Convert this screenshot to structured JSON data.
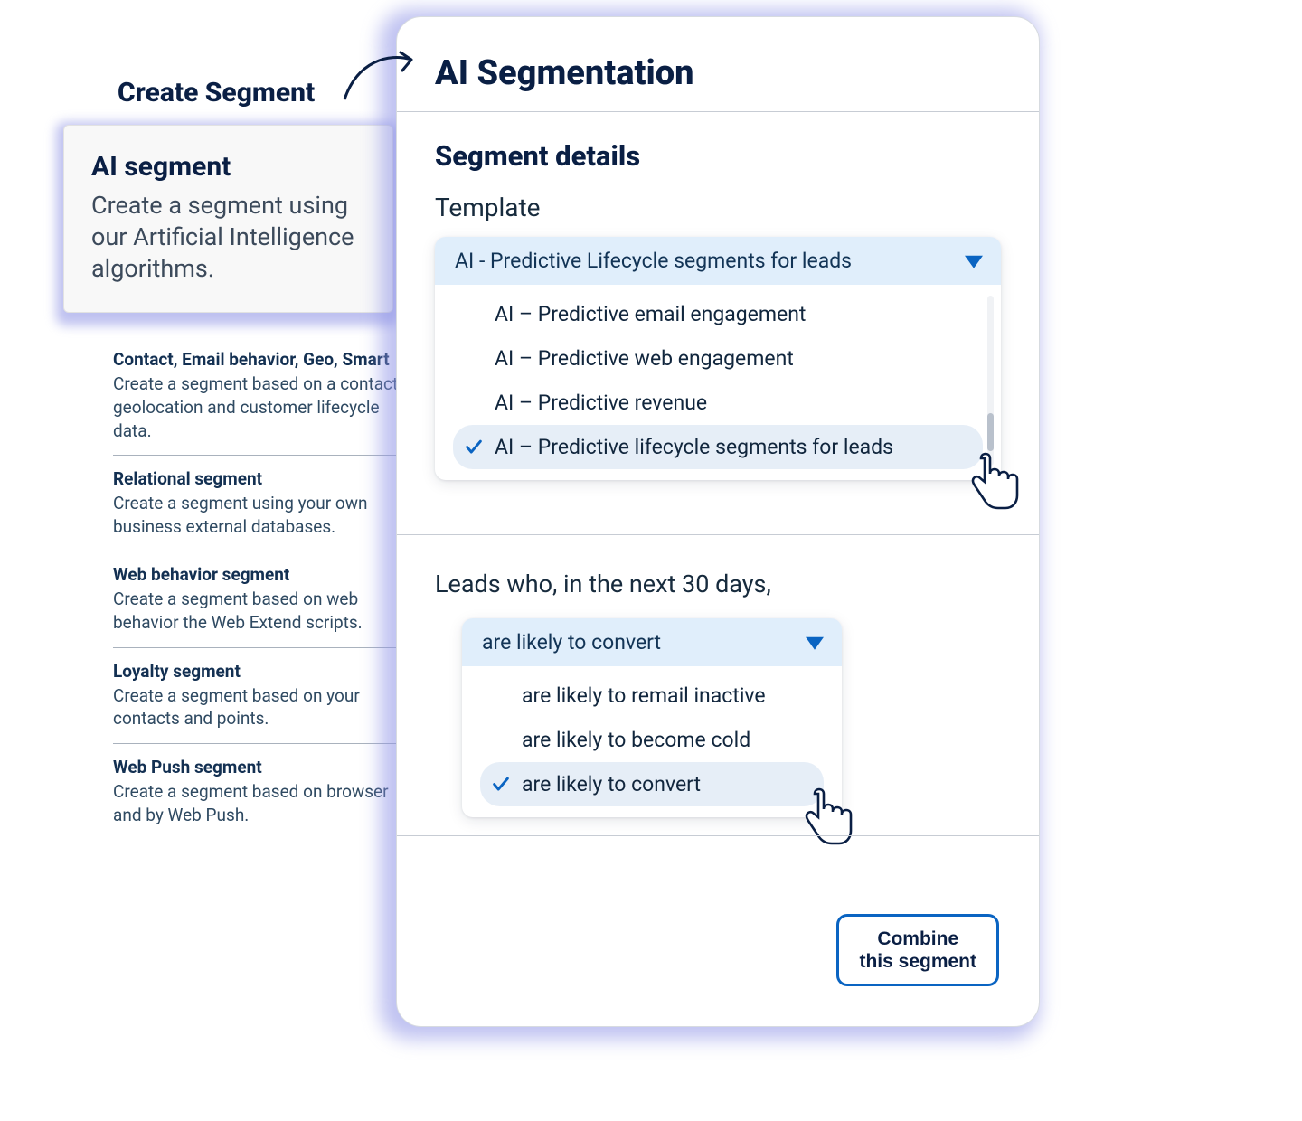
{
  "left": {
    "title": "Create Segment",
    "ai_card": {
      "heading": "AI segment",
      "text": "Create a segment using our Artificial Intelligence algorithms."
    },
    "items": [
      {
        "title": "Contact, Email behavior, Geo, Smart",
        "desc": "Create a segment based on a contact's geolocation and customer lifecycle data."
      },
      {
        "title": "Relational segment",
        "desc": "Create a segment using your own business external databases."
      },
      {
        "title": "Web behavior segment",
        "desc": "Create a segment based on web behavior the Web Extend scripts."
      },
      {
        "title": "Loyalty segment",
        "desc": "Create a segment based on your contacts and points."
      },
      {
        "title": "Web Push segment",
        "desc": "Create a segment based on browser and by Web Push."
      }
    ]
  },
  "right": {
    "title": "AI Segmentation",
    "details_heading": "Segment details",
    "template_label": "Template",
    "template_dropdown": {
      "selected": "AI - Predictive Lifecycle segments for leads",
      "options": [
        "AI – Predictive email engagement",
        "AI – Predictive web engagement",
        "AI – Predictive revenue",
        "AI – Predictive lifecycle segments for leads"
      ],
      "selected_index": 3
    },
    "leads_label": "Leads who, in the next 30 days,",
    "leads_dropdown": {
      "selected": "are likely to convert",
      "options": [
        "are likely to remail inactive",
        "are likely to become cold",
        "are likely to convert"
      ],
      "selected_index": 2
    },
    "combine_button": "Combine\nthis segment"
  }
}
